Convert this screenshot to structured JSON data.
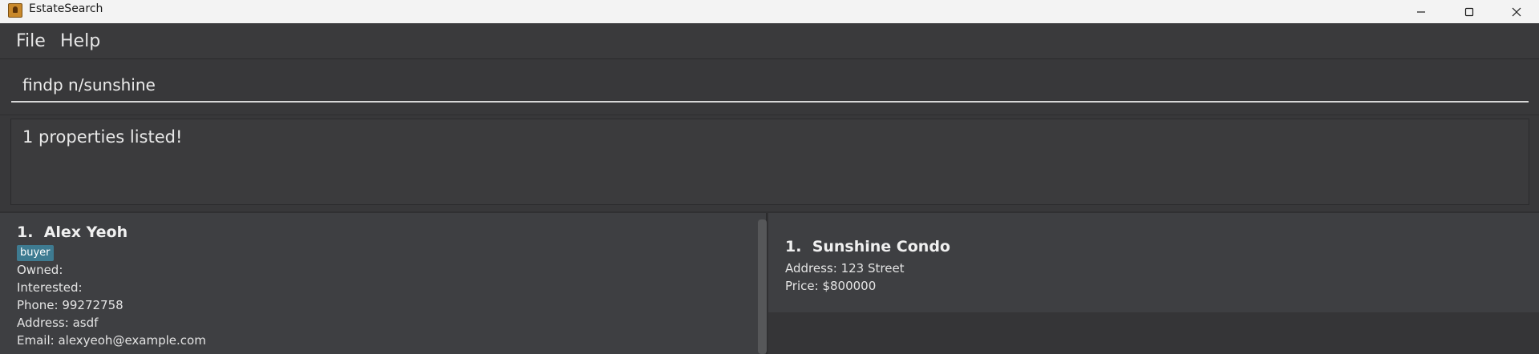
{
  "window": {
    "title": "EstateSearch",
    "controls": [
      "minimize",
      "maximize",
      "close"
    ]
  },
  "menu": {
    "items": [
      {
        "label": "File"
      },
      {
        "label": "Help"
      }
    ]
  },
  "command": {
    "value": "findp n/sunshine"
  },
  "result": {
    "message": "1 properties listed!"
  },
  "persons": [
    {
      "index": "1.",
      "name": "Alex Yeoh",
      "tags": [
        "buyer"
      ],
      "owned_label": "Owned:",
      "interested_label": "Interested:",
      "phone_label": "Phone:",
      "phone": "99272758",
      "address_label": "Address:",
      "address": "asdf",
      "email_label": "Email:",
      "email": "alexyeoh@example.com"
    }
  ],
  "properties": [
    {
      "index": "1.",
      "name": "Sunshine Condo",
      "address_label": "Address:",
      "address": "123 Street",
      "price_label": "Price:",
      "price": "$800000"
    }
  ],
  "colors": {
    "tag_background": "#3e7b91",
    "app_background": "#3f4043"
  }
}
